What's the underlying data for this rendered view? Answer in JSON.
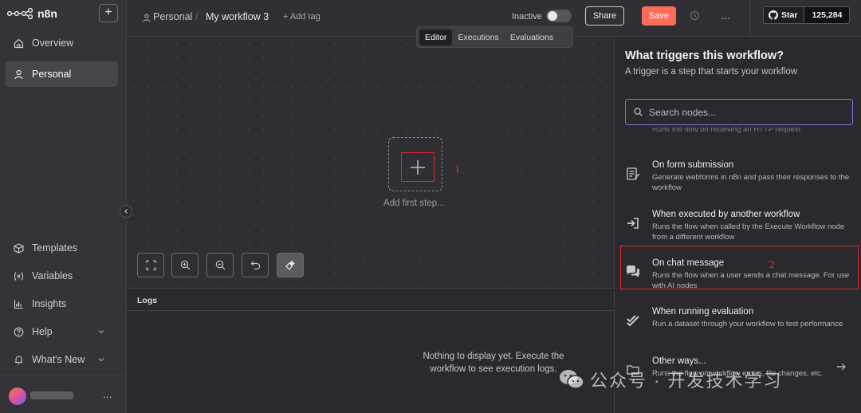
{
  "sidebar": {
    "brand": "n8n",
    "new_button": "+",
    "top_items": [
      {
        "label": "Overview",
        "icon": "home-icon"
      },
      {
        "label": "Personal",
        "icon": "user-icon",
        "active": true
      }
    ],
    "bottom_items": [
      {
        "label": "Templates",
        "icon": "box-icon"
      },
      {
        "label": "Variables",
        "icon": "variables-icon"
      },
      {
        "label": "Insights",
        "icon": "chart-icon"
      },
      {
        "label": "Help",
        "icon": "help-icon"
      },
      {
        "label": "What's New",
        "icon": "bell-icon"
      }
    ],
    "user_menu": "..."
  },
  "topbar": {
    "project": "Personal",
    "separator": "/",
    "workflow_name": "My workflow 3",
    "add_tag": "+ Add tag",
    "status_label": "Inactive",
    "share_label": "Share",
    "save_label": "Save",
    "more": "...",
    "github_star_label": "Star",
    "github_star_count": "125,284"
  },
  "tabs": [
    {
      "label": "Editor",
      "active": true
    },
    {
      "label": "Executions",
      "active": false
    },
    {
      "label": "Evaluations",
      "active": false
    }
  ],
  "canvas": {
    "add_first_step": "Add first step...",
    "annotation_1": "1"
  },
  "logs": {
    "title": "Logs",
    "empty_message": "Nothing to display yet. Execute the workflow to see execution logs."
  },
  "trigger_panel": {
    "title": "What triggers this workflow?",
    "subtitle": "A trigger is a step that starts your workflow",
    "search_placeholder": "Search nodes...",
    "faded_text": "Runs the flow on receiving an HTTP request",
    "annotation_2": "2",
    "items": [
      {
        "title": "On form submission",
        "description": "Generate webforms in n8n and pass their responses to the workflow",
        "icon": "form-icon"
      },
      {
        "title": "When executed by another workflow",
        "description": "Runs the flow when called by the Execute Workflow node from a different workflow",
        "icon": "sign-in-icon"
      },
      {
        "title": "On chat message",
        "description": "Runs the flow when a user sends a chat message. For use with AI nodes",
        "icon": "chat-icon"
      },
      {
        "title": "When running evaluation",
        "description": "Run a dataset through your workflow to test performance",
        "icon": "check-double-icon"
      },
      {
        "title": "Other ways...",
        "description": "Runs the flow on workflow errors, file changes, etc.",
        "icon": "folder-icon"
      }
    ]
  },
  "watermark": {
    "text": "公众号 · 开发技术学习"
  },
  "colors": {
    "accent": "#ff6d5a",
    "search_focus": "#7c72e0",
    "annotation": "#e0292b"
  }
}
